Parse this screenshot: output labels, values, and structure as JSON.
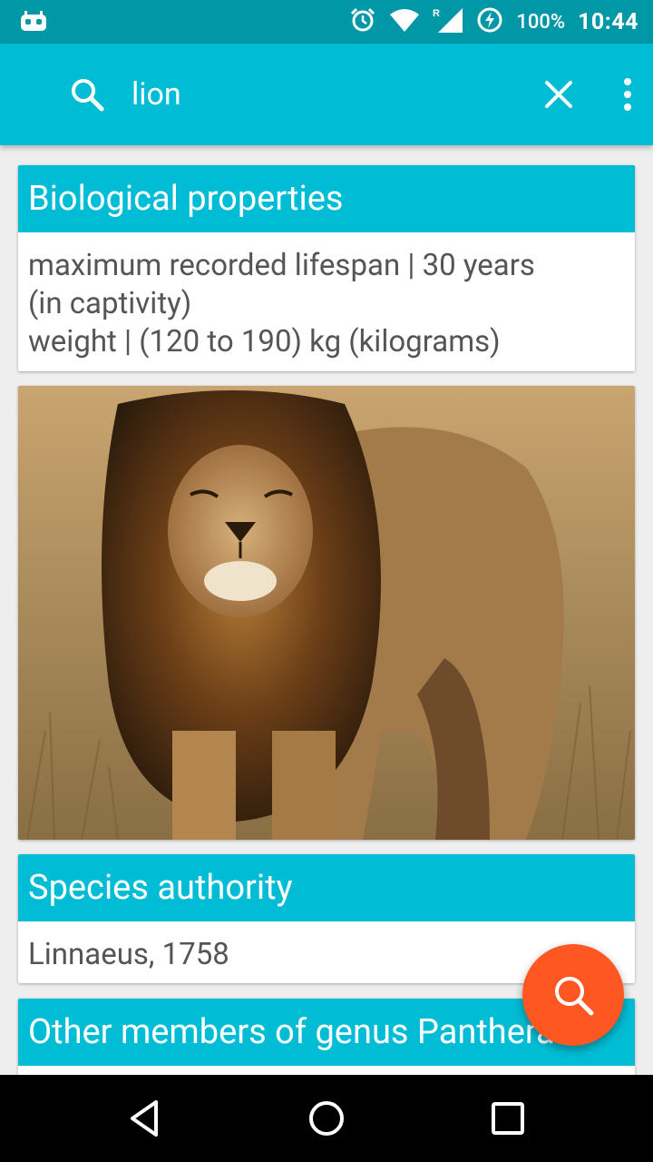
{
  "status_bar": {
    "battery_text": "100%",
    "time": "10:44",
    "icons": [
      "android-debug-icon",
      "alarm-icon",
      "wifi-icon",
      "signal-roaming-icon",
      "battery-charging-icon"
    ]
  },
  "search": {
    "query": "lion"
  },
  "cards": {
    "biological": {
      "header": "Biological properties",
      "line1": "maximum recorded lifespan | 30 years",
      "line2": "(in captivity)",
      "line3": "weight | (120 to 190) kg  (kilograms)"
    },
    "authority": {
      "header": "Species authority",
      "value": "Linnaeus, 1758"
    },
    "genus": {
      "header": "Other members of genus Panthera"
    }
  },
  "colors": {
    "status_bar": "#0097a7",
    "primary": "#00bcd4",
    "accent": "#ff5722",
    "nav_bar": "#000000"
  }
}
